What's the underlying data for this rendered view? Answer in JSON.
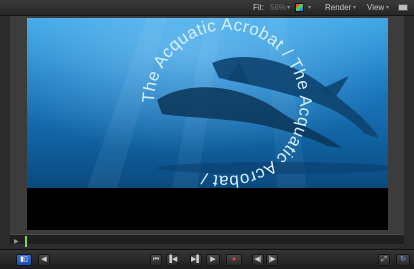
{
  "header": {
    "fit_label": "Fit:",
    "fit_value": "56%",
    "render_label": "Render",
    "view_label": "View"
  },
  "canvas": {
    "title_text": "The Acquatic Acrobat / The Acquatic Acrobat /",
    "water_color": "#1d6fb0",
    "text_color": "#d9f1ff"
  },
  "timeline": {
    "playhead_color": "#7ddc43"
  },
  "transport": {
    "layers_icon": "layers-icon",
    "prev_icon": "◀",
    "to_start_icon": "⏮",
    "step_back_icon": "▐◀",
    "step_forward_icon": "▶▌",
    "play_icon": "▶",
    "record_icon": "●",
    "in_icon": "◀|",
    "out_icon": "|▶",
    "fullscreen_icon": "⤢",
    "loop_icon": "↻"
  }
}
